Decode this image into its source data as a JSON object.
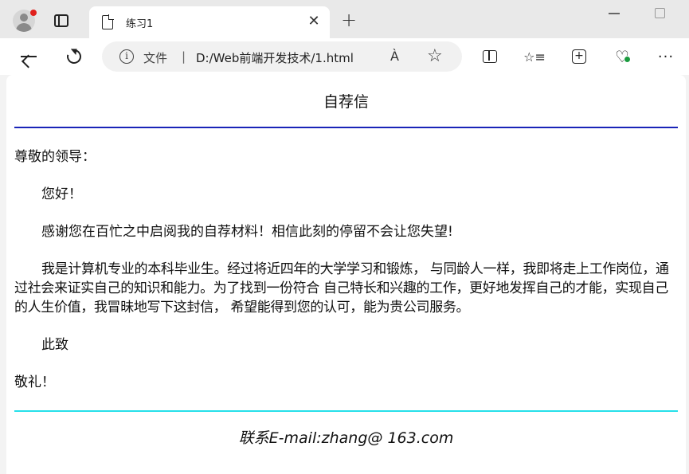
{
  "browser": {
    "tab_title": "练习1",
    "tab_close": "✕",
    "new_tab": "+",
    "address_label": "文件",
    "address_separator": "|",
    "url": "D:/Web前端开发技术/1.html",
    "info_glyph": "i",
    "read_aloud_glyph": "À",
    "favorite_glyph": "☆",
    "favorites_list_glyph": "☆≡",
    "collections_glyph": "+",
    "health_glyph": "♡",
    "more_glyph": "···"
  },
  "page": {
    "title": "自荐信",
    "salutation": "尊敬的领导：",
    "greeting": "您好！",
    "thanks": "感谢您在百忙之中启阅我的自荐材料！相信此刻的停留不会让您失望!",
    "body": "我是计算机专业的本科毕业生。经过将近四年的大学学习和锻炼， 与同龄人一样，我即将走上工作岗位，通过社会来证实自己的知识和能力。为了找到一份符合 自己特长和兴趣的工作，更好地发挥自己的才能，实现自己的人生价值，我冒昧地写下这封信， 希望能得到您的认可，能为贵公司服务。",
    "closing_1": "此致",
    "closing_2": "敬礼！",
    "contact": "联系E-mail:zhang@ 163.com",
    "rule_top_color": "#1a24b8",
    "rule_bottom_color": "#26e0ea"
  }
}
